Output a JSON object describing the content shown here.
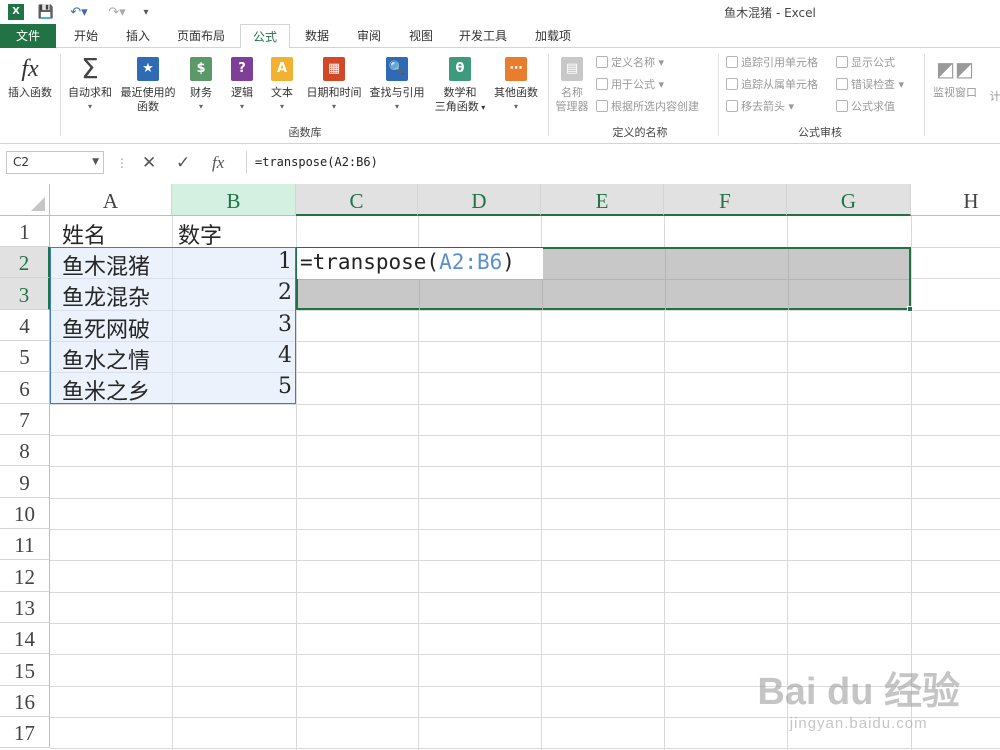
{
  "window": {
    "title": "鱼木混猪 - Excel"
  },
  "tabs": [
    {
      "label": "文件"
    },
    {
      "label": "开始"
    },
    {
      "label": "插入"
    },
    {
      "label": "页面布局"
    },
    {
      "label": "公式"
    },
    {
      "label": "数据"
    },
    {
      "label": "审阅"
    },
    {
      "label": "视图"
    },
    {
      "label": "开发工具"
    },
    {
      "label": "加载项"
    }
  ],
  "ribbon": {
    "insert_function": "插入函数",
    "autosum": "自动求和",
    "recent": "最近使用的",
    "recent2": "函数",
    "financial": "财务",
    "logical": "逻辑",
    "text": "文本",
    "datetime": "日期和时间",
    "lookup": "查找与引用",
    "math": "数学和",
    "math2": "三角函数",
    "more": "其他函数",
    "group_library": "函数库",
    "name_manager": "名称",
    "name_manager2": "管理器",
    "define_name": "定义名称",
    "use_in_formula": "用于公式",
    "create_from_selection": "根据所选内容创建",
    "group_names": "定义的名称",
    "trace_precedents": "追踪引用单元格",
    "trace_dependents": "追踪从属单元格",
    "remove_arrows": "移去箭头",
    "show_formulas": "显示公式",
    "error_check": "错误检查",
    "evaluate": "公式求值",
    "group_audit": "公式审核",
    "watch_window": "监视窗口",
    "calc_partial": "计"
  },
  "formula_bar": {
    "name_box": "C2",
    "formula": "=transpose(A2:B6)",
    "fx": "fx"
  },
  "grid": {
    "columns": [
      "A",
      "B",
      "C",
      "D",
      "E",
      "F",
      "G",
      "H"
    ],
    "rows": [
      "1",
      "2",
      "3",
      "4",
      "5",
      "6",
      "7",
      "8",
      "9",
      "10",
      "11",
      "12",
      "13",
      "14",
      "15",
      "16",
      "17"
    ],
    "cells": {
      "A1": "姓名",
      "B1": "数字",
      "A2": "鱼木混猪",
      "B2": "1",
      "A3": "鱼龙混杂",
      "B3": "2",
      "A4": "鱼死网破",
      "B4": "3",
      "A5": "鱼水之情",
      "B5": "4",
      "A6": "鱼米之乡",
      "B6": "5"
    },
    "edit_prefix": "=transpose(",
    "edit_ref": "A2:B6",
    "edit_suffix": ")"
  },
  "watermark": {
    "main": "Bai du 经验",
    "sub": "jingyan.baidu.com"
  },
  "colors": {
    "accent": "#217346",
    "ref": "#3e7ec0"
  }
}
